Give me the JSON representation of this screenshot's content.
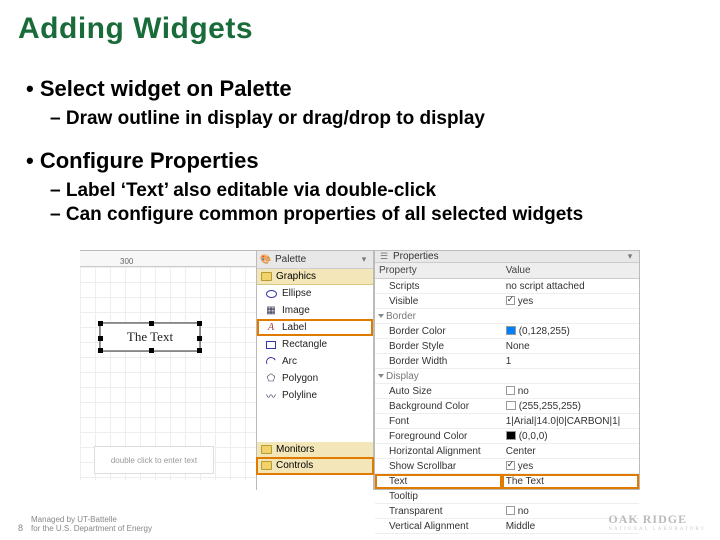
{
  "title": "Adding Widgets",
  "bullets": {
    "b1": "Select widget on Palette",
    "b1a": "Draw outline in display or drag/drop to display",
    "b2": "Configure Properties",
    "b2a": "Label ‘Text’ also editable via double-click",
    "b2b": "Can configure common properties of all selected widgets"
  },
  "canvas": {
    "ruler_mark": "300",
    "widget_text": "The Text",
    "hint": "double click to enter text"
  },
  "palette": {
    "title": "Palette",
    "cats": {
      "graphics": "Graphics",
      "monitors": "Monitors",
      "controls": "Controls"
    },
    "items": {
      "ellipse": "Ellipse",
      "image": "Image",
      "label": "Label",
      "rectangle": "Rectangle",
      "arc": "Arc",
      "polygon": "Polygon",
      "polyline": "Polyline"
    }
  },
  "props": {
    "title": "Properties",
    "col_prop": "Property",
    "col_val": "Value",
    "rows": {
      "scripts": {
        "k": "Scripts",
        "v": "no script attached"
      },
      "visible": {
        "k": "Visible",
        "v": "yes"
      },
      "g_border": {
        "k": "Border"
      },
      "bcolor": {
        "k": "Border Color",
        "v": "(0,128,255)"
      },
      "bstyle": {
        "k": "Border Style",
        "v": "None"
      },
      "bwidth": {
        "k": "Border Width",
        "v": "1"
      },
      "g_display": {
        "k": "Display"
      },
      "autosize": {
        "k": "Auto Size",
        "v": "no"
      },
      "bgcolor": {
        "k": "Background Color",
        "v": "(255,255,255)"
      },
      "font": {
        "k": "Font",
        "v": "1|Arial|14.0|0|CARBON|1|"
      },
      "fgcolor": {
        "k": "Foreground Color",
        "v": "(0,0,0)"
      },
      "halign": {
        "k": "Horizontal Alignment",
        "v": "Center"
      },
      "scroll": {
        "k": "Show Scrollbar",
        "v": "yes"
      },
      "text": {
        "k": "Text",
        "v": "The Text"
      },
      "tooltip": {
        "k": "Tooltip",
        "v": ""
      },
      "transp": {
        "k": "Transparent",
        "v": "no"
      },
      "valign": {
        "k": "Vertical Alignment",
        "v": "Middle"
      }
    }
  },
  "footer": {
    "page": "8",
    "line1": "Managed by UT-Battelle",
    "line2": "for the U.S. Department of Energy",
    "logo": "OAK RIDGE",
    "logo_sub": "NATIONAL LABORATORY"
  }
}
